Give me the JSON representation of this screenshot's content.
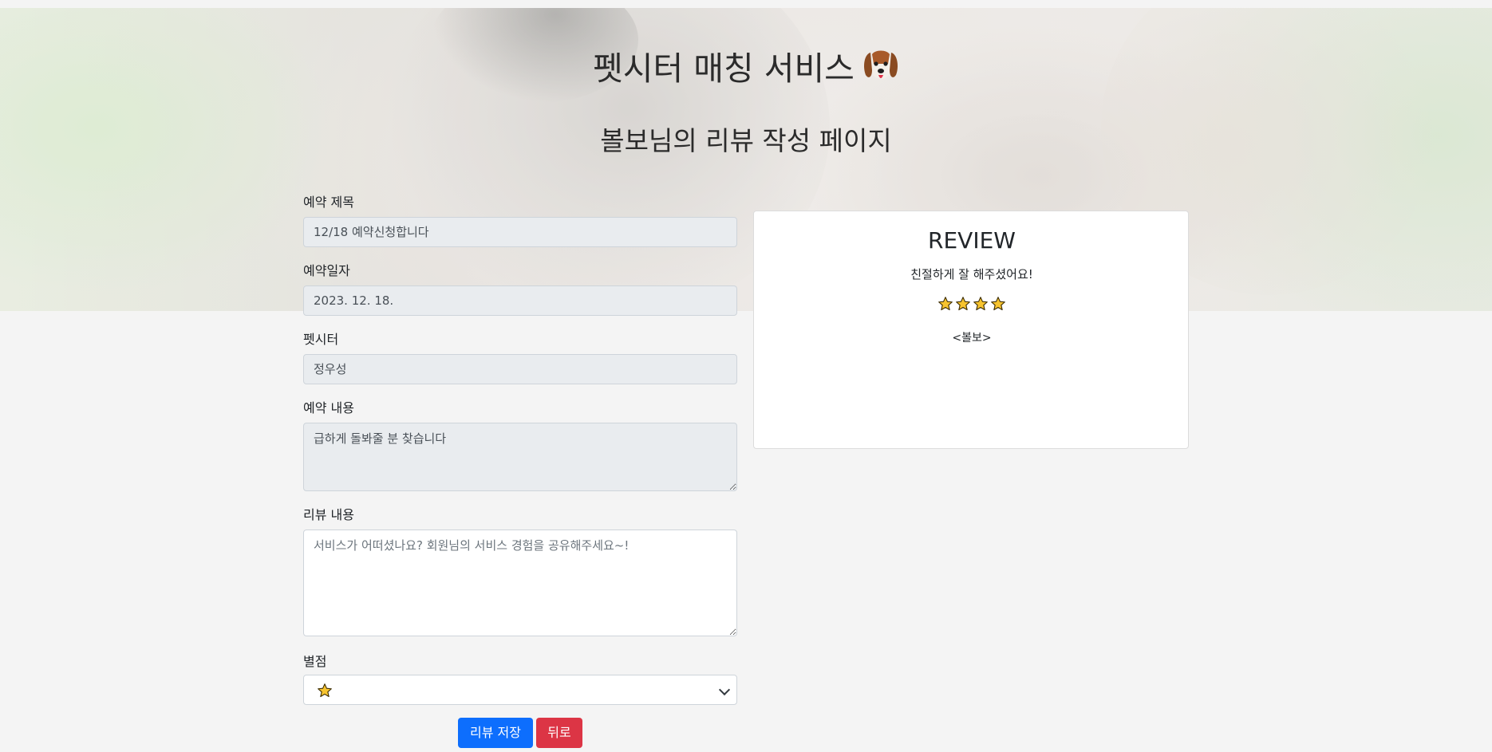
{
  "header": {
    "title": "펫시터 매칭 서비스",
    "subtitle": "볼보님의 리뷰 작성 페이지"
  },
  "form": {
    "reservation_title_label": "예약 제목",
    "reservation_title_value": "12/18 예약신청합니다",
    "reservation_date_label": "예약일자",
    "reservation_date_value": "2023. 12. 18.",
    "petsitter_label": "펫시터",
    "petsitter_value": "정우성",
    "reservation_content_label": "예약 내용",
    "reservation_content_value": "급하게 돌봐줄 분 찾습니다",
    "review_content_label": "리뷰 내용",
    "review_content_placeholder": "서비스가 어떠셨나요? 회원님의 서비스 경험을 공유해주세요~!",
    "rating_label": "별점",
    "rating_selected_stars": 1
  },
  "buttons": {
    "save_label": "리뷰 저장",
    "back_label": "뒤로"
  },
  "review": {
    "heading": "REVIEW",
    "text": "친절하게 잘 해주셨어요!",
    "stars": 4,
    "author": "<볼보>"
  },
  "colors": {
    "primary": "#0d6efd",
    "danger": "#dc3545",
    "star": "#f7c42f"
  }
}
